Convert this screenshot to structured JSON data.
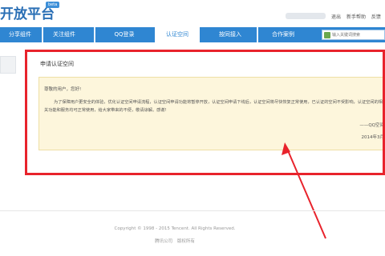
{
  "header": {
    "logo_text": "开放平台",
    "beta_badge": "beta",
    "top_links": [
      "退出",
      "新手帮助",
      "反馈"
    ]
  },
  "nav": {
    "items": [
      {
        "label": "分享组件"
      },
      {
        "label": "关注组件"
      },
      {
        "label": "QQ登录"
      },
      {
        "label": "认证空间"
      },
      {
        "label": "按同接入"
      },
      {
        "label": "合作案例"
      }
    ],
    "active_index": 3,
    "search_placeholder": "输入关键词搜索"
  },
  "card": {
    "title": "申请认证空间"
  },
  "notice": {
    "greeting": "尊敬的用户，您好!",
    "body": "为了保障用户更安全的体验，优化认证空间申请流程，认证空间申请功能将暂停开放，认证空间申请下线后，认证空间将尽快恢复正常使用，已认证的空间不受影响，认证空间的相关功能和服务均可正常使用，给大家带来的不便，敬请谅解。感谢!",
    "signature": "——QQ空间",
    "date": "2014年3月"
  },
  "footer": {
    "copyright": "Copyright © 1998 - 2015 Tencent. All Rights Reserved.",
    "links": [
      "腾讯公司",
      "版权所有"
    ]
  },
  "colors": {
    "nav_bg": "#2f86d2",
    "notice_bg": "#fdf6dc",
    "highlight": "#e8232c"
  }
}
